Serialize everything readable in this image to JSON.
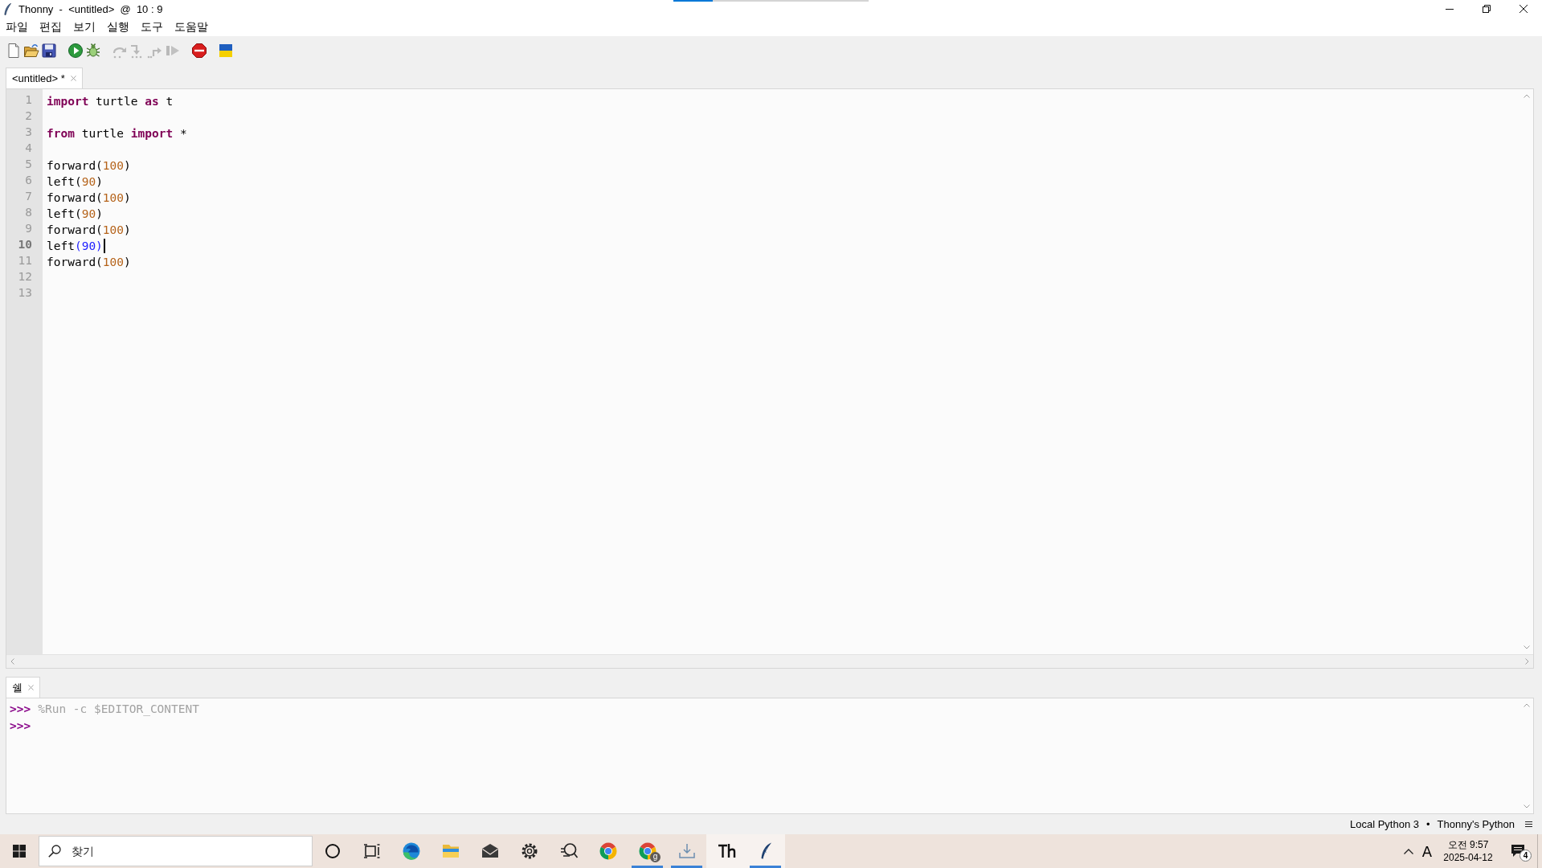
{
  "window": {
    "title": "Thonny  -  <untitled>  @  10 : 9"
  },
  "top_progress": {
    "level": 0.2
  },
  "menu": [
    "파일",
    "편집",
    "보기",
    "실행",
    "도구",
    "도움말"
  ],
  "toolbar": [
    {
      "kind": "new",
      "disabled": false
    },
    {
      "kind": "open",
      "disabled": false
    },
    {
      "kind": "save",
      "disabled": false
    },
    {
      "kind": "run",
      "disabled": false
    },
    {
      "kind": "debug",
      "disabled": false
    },
    {
      "kind": "step-over",
      "disabled": true
    },
    {
      "kind": "step-into",
      "disabled": true
    },
    {
      "kind": "step-out",
      "disabled": true
    },
    {
      "kind": "resume",
      "disabled": true
    },
    {
      "kind": "stop",
      "disabled": false
    },
    {
      "kind": "flag",
      "disabled": false
    }
  ],
  "editor": {
    "tabs": [
      {
        "label": "<untitled> *",
        "selected": true
      }
    ],
    "lines": [
      {
        "number": "1",
        "current": false,
        "tokens": [
          {
            "text": "import",
            "kind": "keyword"
          },
          {
            "text": " turtle ",
            "kind": "plain"
          },
          {
            "text": "as",
            "kind": "keyword"
          },
          {
            "text": " t",
            "kind": "plain"
          }
        ]
      },
      {
        "number": "2",
        "current": false
      },
      {
        "number": "3",
        "current": false,
        "tokens": [
          {
            "text": "from",
            "kind": "keyword"
          },
          {
            "text": " turtle ",
            "kind": "plain"
          },
          {
            "text": "import",
            "kind": "keyword"
          },
          {
            "text": " *",
            "kind": "plain"
          }
        ]
      },
      {
        "number": "4",
        "current": false
      },
      {
        "number": "5",
        "current": false,
        "tokens": [
          {
            "text": "forward(",
            "kind": "plain"
          },
          {
            "text": "100",
            "kind": "number"
          },
          {
            "text": ")",
            "kind": "plain"
          }
        ]
      },
      {
        "number": "6",
        "current": false,
        "tokens": [
          {
            "text": "left(",
            "kind": "plain"
          },
          {
            "text": "90",
            "kind": "number"
          },
          {
            "text": ")",
            "kind": "plain"
          }
        ]
      },
      {
        "number": "7",
        "current": false,
        "tokens": [
          {
            "text": "forward(",
            "kind": "plain"
          },
          {
            "text": "100",
            "kind": "number"
          },
          {
            "text": ")",
            "kind": "plain"
          }
        ]
      },
      {
        "number": "8",
        "current": false,
        "tokens": [
          {
            "text": "left(",
            "kind": "plain"
          },
          {
            "text": "90",
            "kind": "number"
          },
          {
            "text": ")",
            "kind": "plain"
          }
        ]
      },
      {
        "number": "9",
        "current": false,
        "tokens": [
          {
            "text": "forward(",
            "kind": "plain"
          },
          {
            "text": "100",
            "kind": "number"
          },
          {
            "text": ")",
            "kind": "plain"
          }
        ]
      },
      {
        "number": "10",
        "current": true,
        "tokens": [
          {
            "text": "left",
            "kind": "plain"
          },
          {
            "text": "(90)",
            "kind": "match"
          }
        ]
      },
      {
        "number": "11",
        "current": false,
        "tokens": [
          {
            "text": "forward(",
            "kind": "plain"
          },
          {
            "text": "100",
            "kind": "number"
          },
          {
            "text": ")",
            "kind": "plain"
          }
        ]
      },
      {
        "number": "12",
        "current": false
      },
      {
        "number": "13",
        "current": false
      }
    ]
  },
  "shell": {
    "tabs": [
      {
        "label": "쉘",
        "selected": true
      }
    ],
    "lines": [
      {
        "prompt": ">>>",
        "text": "%Run -c $EDITOR_CONTENT"
      },
      {
        "prompt": ">>>"
      }
    ]
  },
  "status_bar": {
    "items": [
      "Local Python 3",
      "•",
      "Thonny's Python"
    ]
  },
  "taskbar": {
    "search": {
      "placeholder": "찾기"
    },
    "apps": [
      {
        "kind": "cortana",
        "running": false,
        "highlighted": false
      },
      {
        "kind": "task-view",
        "running": false,
        "highlighted": false
      },
      {
        "kind": "edge",
        "running": false,
        "highlighted": false
      },
      {
        "kind": "explorer",
        "running": false,
        "highlighted": false
      },
      {
        "kind": "mail",
        "running": false,
        "highlighted": false
      },
      {
        "kind": "settings",
        "running": false,
        "highlighted": false
      },
      {
        "kind": "feedback",
        "running": false,
        "highlighted": false
      },
      {
        "kind": "chrome",
        "running": false,
        "highlighted": false
      },
      {
        "kind": "chrome",
        "badge": "g",
        "running": true,
        "highlighted": false
      },
      {
        "kind": "download",
        "running": true,
        "highlighted": false
      },
      {
        "kind": "typora",
        "running": false,
        "highlighted": true
      },
      {
        "kind": "thonny",
        "running": true,
        "highlighted": true
      }
    ],
    "tray": {
      "ime": "A",
      "time": "오전 9:57",
      "date": "2025-04-12",
      "notification_count": "4"
    }
  }
}
